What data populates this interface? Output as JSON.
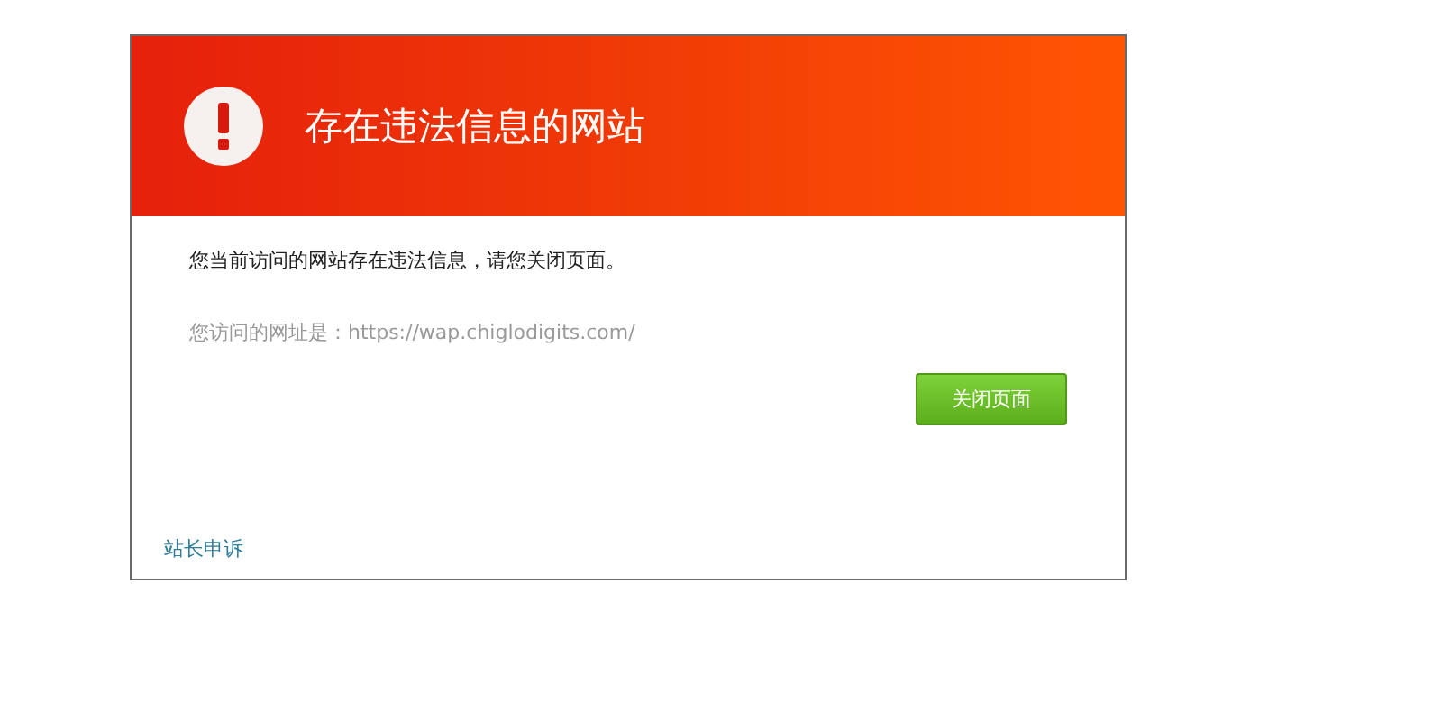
{
  "dialog": {
    "title": "存在违法信息的网站",
    "message": "您当前访问的网站存在违法信息，请您关闭页面。",
    "url_line": "您访问的网址是：https://wap.chiglodigits.com/",
    "close_button": "关闭页面",
    "appeal_link": "站长申诉"
  }
}
